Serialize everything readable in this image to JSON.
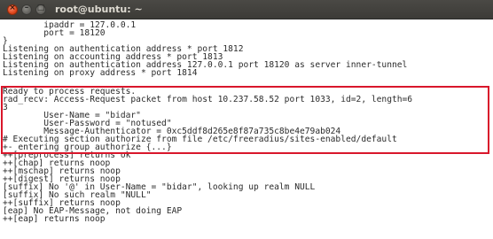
{
  "window": {
    "title": "root@ubuntu: ~"
  },
  "terminal": {
    "lines": [
      "        ipaddr = 127.0.0.1",
      "        port = 18120",
      "}",
      "Listening on authentication address * port 1812",
      "Listening on accounting address * port 1813",
      "Listening on authentication address 127.0.0.1 port 18120 as server inner-tunnel",
      "Listening on proxy address * port 1814",
      "Ready to process requests.",
      "rad_recv: Access-Request packet from host 10.237.58.52 port 1033, id=2, length=6",
      "3",
      "        User-Name = \"bidar\"",
      "        User-Password = \"notused\"",
      "        Message-Authenticator = 0xc5ddf8d265e8f87a735c8be4e79ab024",
      "# Executing section authorize from file /etc/freeradius/sites-enabled/default",
      "+- entering group authorize {...}",
      "++[preprocess] returns ok",
      "++[chap] returns noop",
      "++[mschap] returns noop",
      "++[digest] returns noop",
      "[suffix] No '@' in User-Name = \"bidar\", looking up realm NULL",
      "[suffix] No such realm \"NULL\"",
      "++[suffix] returns noop",
      "[eap] No EAP-Message, not doing EAP",
      "++[eap] returns noop"
    ]
  },
  "annotation": {
    "highlight_color": "#d9172b"
  }
}
